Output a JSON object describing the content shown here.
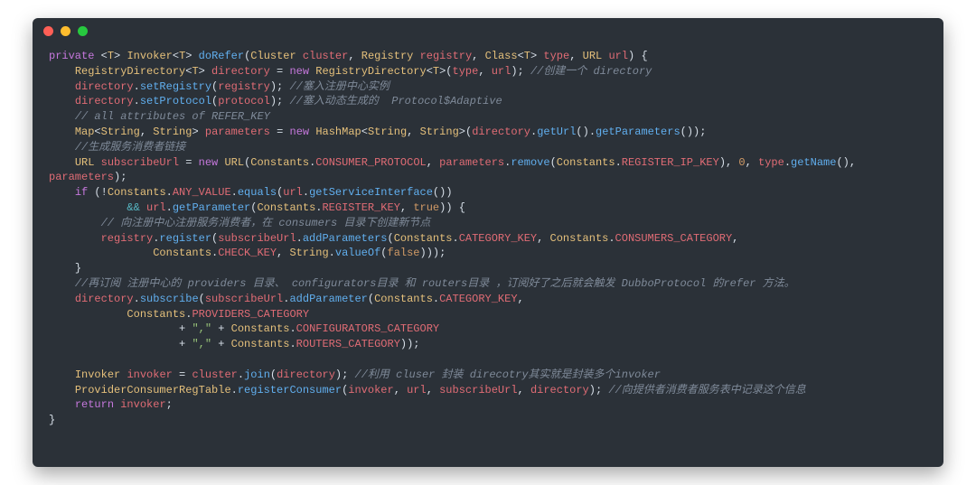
{
  "window": {
    "traffic_colors": {
      "close": "#ff5f56",
      "min": "#ffbd2e",
      "max": "#27c93f"
    }
  },
  "editor": {
    "theme": {
      "bg": "#2b3138",
      "fg": "#d7dfe8",
      "keyword": "#c678dd",
      "type": "#e5c07b",
      "identifier": "#e06c75",
      "method": "#61afef",
      "string": "#98c379",
      "number": "#d19a66",
      "comment": "#7f8a99",
      "operator": "#56b6c2"
    },
    "lines": [
      {
        "ind": 0,
        "t": [
          {
            "c": "kw",
            "s": "private"
          },
          {
            "c": "pln",
            "s": " <"
          },
          {
            "c": "type",
            "s": "T"
          },
          {
            "c": "pln",
            "s": "> "
          },
          {
            "c": "type",
            "s": "Invoker"
          },
          {
            "c": "pln",
            "s": "<"
          },
          {
            "c": "type",
            "s": "T"
          },
          {
            "c": "pln",
            "s": "> "
          },
          {
            "c": "fn",
            "s": "doRefer"
          },
          {
            "c": "pln",
            "s": "("
          },
          {
            "c": "type",
            "s": "Cluster"
          },
          {
            "c": "pln",
            "s": " "
          },
          {
            "c": "id",
            "s": "cluster"
          },
          {
            "c": "pln",
            "s": ", "
          },
          {
            "c": "type",
            "s": "Registry"
          },
          {
            "c": "pln",
            "s": " "
          },
          {
            "c": "id",
            "s": "registry"
          },
          {
            "c": "pln",
            "s": ", "
          },
          {
            "c": "type",
            "s": "Class"
          },
          {
            "c": "pln",
            "s": "<"
          },
          {
            "c": "type",
            "s": "T"
          },
          {
            "c": "pln",
            "s": "> "
          },
          {
            "c": "id",
            "s": "type"
          },
          {
            "c": "pln",
            "s": ", "
          },
          {
            "c": "type",
            "s": "URL"
          },
          {
            "c": "pln",
            "s": " "
          },
          {
            "c": "id",
            "s": "url"
          },
          {
            "c": "pln",
            "s": ") {"
          }
        ]
      },
      {
        "ind": 1,
        "t": [
          {
            "c": "type",
            "s": "RegistryDirectory"
          },
          {
            "c": "pln",
            "s": "<"
          },
          {
            "c": "type",
            "s": "T"
          },
          {
            "c": "pln",
            "s": "> "
          },
          {
            "c": "id",
            "s": "directory"
          },
          {
            "c": "pln",
            "s": " = "
          },
          {
            "c": "kw",
            "s": "new"
          },
          {
            "c": "pln",
            "s": " "
          },
          {
            "c": "type",
            "s": "RegistryDirectory"
          },
          {
            "c": "pln",
            "s": "<"
          },
          {
            "c": "type",
            "s": "T"
          },
          {
            "c": "pln",
            "s": ">("
          },
          {
            "c": "id",
            "s": "type"
          },
          {
            "c": "pln",
            "s": ", "
          },
          {
            "c": "id",
            "s": "url"
          },
          {
            "c": "pln",
            "s": "); "
          },
          {
            "c": "cmt",
            "s": "//创建一个 directory"
          }
        ]
      },
      {
        "ind": 1,
        "t": [
          {
            "c": "id",
            "s": "directory"
          },
          {
            "c": "pln",
            "s": "."
          },
          {
            "c": "fn",
            "s": "setRegistry"
          },
          {
            "c": "pln",
            "s": "("
          },
          {
            "c": "id",
            "s": "registry"
          },
          {
            "c": "pln",
            "s": "); "
          },
          {
            "c": "cmt",
            "s": "//塞入注册中心实例"
          }
        ]
      },
      {
        "ind": 1,
        "t": [
          {
            "c": "id",
            "s": "directory"
          },
          {
            "c": "pln",
            "s": "."
          },
          {
            "c": "fn",
            "s": "setProtocol"
          },
          {
            "c": "pln",
            "s": "("
          },
          {
            "c": "id",
            "s": "protocol"
          },
          {
            "c": "pln",
            "s": "); "
          },
          {
            "c": "cmt",
            "s": "//塞入动态生成的  Protocol$Adaptive"
          }
        ]
      },
      {
        "ind": 1,
        "t": [
          {
            "c": "cmt",
            "s": "// all attributes of REFER_KEY"
          }
        ]
      },
      {
        "ind": 1,
        "t": [
          {
            "c": "type",
            "s": "Map"
          },
          {
            "c": "pln",
            "s": "<"
          },
          {
            "c": "type",
            "s": "String"
          },
          {
            "c": "pln",
            "s": ", "
          },
          {
            "c": "type",
            "s": "String"
          },
          {
            "c": "pln",
            "s": "> "
          },
          {
            "c": "id",
            "s": "parameters"
          },
          {
            "c": "pln",
            "s": " = "
          },
          {
            "c": "kw",
            "s": "new"
          },
          {
            "c": "pln",
            "s": " "
          },
          {
            "c": "type",
            "s": "HashMap"
          },
          {
            "c": "pln",
            "s": "<"
          },
          {
            "c": "type",
            "s": "String"
          },
          {
            "c": "pln",
            "s": ", "
          },
          {
            "c": "type",
            "s": "String"
          },
          {
            "c": "pln",
            "s": ">("
          },
          {
            "c": "id",
            "s": "directory"
          },
          {
            "c": "pln",
            "s": "."
          },
          {
            "c": "fn",
            "s": "getUrl"
          },
          {
            "c": "pln",
            "s": "()."
          },
          {
            "c": "fn",
            "s": "getParameters"
          },
          {
            "c": "pln",
            "s": "());"
          }
        ]
      },
      {
        "ind": 1,
        "t": [
          {
            "c": "cmt",
            "s": "//生成服务消费者链接"
          }
        ]
      },
      {
        "ind": 1,
        "t": [
          {
            "c": "type",
            "s": "URL"
          },
          {
            "c": "pln",
            "s": " "
          },
          {
            "c": "id",
            "s": "subscribeUrl"
          },
          {
            "c": "pln",
            "s": " = "
          },
          {
            "c": "kw",
            "s": "new"
          },
          {
            "c": "pln",
            "s": " "
          },
          {
            "c": "type",
            "s": "URL"
          },
          {
            "c": "pln",
            "s": "("
          },
          {
            "c": "type",
            "s": "Constants"
          },
          {
            "c": "pln",
            "s": "."
          },
          {
            "c": "id",
            "s": "CONSUMER_PROTOCOL"
          },
          {
            "c": "pln",
            "s": ", "
          },
          {
            "c": "id",
            "s": "parameters"
          },
          {
            "c": "pln",
            "s": "."
          },
          {
            "c": "fn",
            "s": "remove"
          },
          {
            "c": "pln",
            "s": "("
          },
          {
            "c": "type",
            "s": "Constants"
          },
          {
            "c": "pln",
            "s": "."
          },
          {
            "c": "id",
            "s": "REGISTER_IP_KEY"
          },
          {
            "c": "pln",
            "s": "), "
          },
          {
            "c": "num",
            "s": "0"
          },
          {
            "c": "pln",
            "s": ", "
          },
          {
            "c": "id",
            "s": "type"
          },
          {
            "c": "pln",
            "s": "."
          },
          {
            "c": "fn",
            "s": "getName"
          },
          {
            "c": "pln",
            "s": "(), "
          }
        ]
      },
      {
        "ind": 0,
        "t": [
          {
            "c": "id",
            "s": "parameters"
          },
          {
            "c": "pln",
            "s": ");"
          }
        ]
      },
      {
        "ind": 1,
        "t": [
          {
            "c": "kw",
            "s": "if"
          },
          {
            "c": "pln",
            "s": " (!"
          },
          {
            "c": "type",
            "s": "Constants"
          },
          {
            "c": "pln",
            "s": "."
          },
          {
            "c": "id",
            "s": "ANY_VALUE"
          },
          {
            "c": "pln",
            "s": "."
          },
          {
            "c": "fn",
            "s": "equals"
          },
          {
            "c": "pln",
            "s": "("
          },
          {
            "c": "id",
            "s": "url"
          },
          {
            "c": "pln",
            "s": "."
          },
          {
            "c": "fn",
            "s": "getServiceInterface"
          },
          {
            "c": "pln",
            "s": "())"
          }
        ]
      },
      {
        "ind": 3,
        "t": [
          {
            "c": "op",
            "s": "&&"
          },
          {
            "c": "pln",
            "s": " "
          },
          {
            "c": "id",
            "s": "url"
          },
          {
            "c": "pln",
            "s": "."
          },
          {
            "c": "fn",
            "s": "getParameter"
          },
          {
            "c": "pln",
            "s": "("
          },
          {
            "c": "type",
            "s": "Constants"
          },
          {
            "c": "pln",
            "s": "."
          },
          {
            "c": "id",
            "s": "REGISTER_KEY"
          },
          {
            "c": "pln",
            "s": ", "
          },
          {
            "c": "num",
            "s": "true"
          },
          {
            "c": "pln",
            "s": ")) {"
          }
        ]
      },
      {
        "ind": 2,
        "t": [
          {
            "c": "cmt",
            "s": "// 向注册中心注册服务消费者，在 consumers 目录下创建新节点"
          }
        ]
      },
      {
        "ind": 2,
        "t": [
          {
            "c": "id",
            "s": "registry"
          },
          {
            "c": "pln",
            "s": "."
          },
          {
            "c": "fn",
            "s": "register"
          },
          {
            "c": "pln",
            "s": "("
          },
          {
            "c": "id",
            "s": "subscribeUrl"
          },
          {
            "c": "pln",
            "s": "."
          },
          {
            "c": "fn",
            "s": "addParameters"
          },
          {
            "c": "pln",
            "s": "("
          },
          {
            "c": "type",
            "s": "Constants"
          },
          {
            "c": "pln",
            "s": "."
          },
          {
            "c": "id",
            "s": "CATEGORY_KEY"
          },
          {
            "c": "pln",
            "s": ", "
          },
          {
            "c": "type",
            "s": "Constants"
          },
          {
            "c": "pln",
            "s": "."
          },
          {
            "c": "id",
            "s": "CONSUMERS_CATEGORY"
          },
          {
            "c": "pln",
            "s": ","
          }
        ]
      },
      {
        "ind": 4,
        "t": [
          {
            "c": "type",
            "s": "Constants"
          },
          {
            "c": "pln",
            "s": "."
          },
          {
            "c": "id",
            "s": "CHECK_KEY"
          },
          {
            "c": "pln",
            "s": ", "
          },
          {
            "c": "type",
            "s": "String"
          },
          {
            "c": "pln",
            "s": "."
          },
          {
            "c": "fn",
            "s": "valueOf"
          },
          {
            "c": "pln",
            "s": "("
          },
          {
            "c": "num",
            "s": "false"
          },
          {
            "c": "pln",
            "s": ")));"
          }
        ]
      },
      {
        "ind": 1,
        "t": [
          {
            "c": "pln",
            "s": "}"
          }
        ]
      },
      {
        "ind": 1,
        "t": [
          {
            "c": "cmt",
            "s": "//再订阅 注册中心的 providers 目录、 configurators目录 和 routers目录 ，订阅好了之后就会触发 DubboProtocol 的refer 方法。"
          }
        ]
      },
      {
        "ind": 1,
        "t": [
          {
            "c": "id",
            "s": "directory"
          },
          {
            "c": "pln",
            "s": "."
          },
          {
            "c": "fn",
            "s": "subscribe"
          },
          {
            "c": "pln",
            "s": "("
          },
          {
            "c": "id",
            "s": "subscribeUrl"
          },
          {
            "c": "pln",
            "s": "."
          },
          {
            "c": "fn",
            "s": "addParameter"
          },
          {
            "c": "pln",
            "s": "("
          },
          {
            "c": "type",
            "s": "Constants"
          },
          {
            "c": "pln",
            "s": "."
          },
          {
            "c": "id",
            "s": "CATEGORY_KEY"
          },
          {
            "c": "pln",
            "s": ","
          }
        ]
      },
      {
        "ind": 3,
        "t": [
          {
            "c": "type",
            "s": "Constants"
          },
          {
            "c": "pln",
            "s": "."
          },
          {
            "c": "id",
            "s": "PROVIDERS_CATEGORY"
          }
        ]
      },
      {
        "ind": 5,
        "t": [
          {
            "c": "pln",
            "s": "+ "
          },
          {
            "c": "str",
            "s": "\",\""
          },
          {
            "c": "pln",
            "s": " + "
          },
          {
            "c": "type",
            "s": "Constants"
          },
          {
            "c": "pln",
            "s": "."
          },
          {
            "c": "id",
            "s": "CONFIGURATORS_CATEGORY"
          }
        ]
      },
      {
        "ind": 5,
        "t": [
          {
            "c": "pln",
            "s": "+ "
          },
          {
            "c": "str",
            "s": "\",\""
          },
          {
            "c": "pln",
            "s": " + "
          },
          {
            "c": "type",
            "s": "Constants"
          },
          {
            "c": "pln",
            "s": "."
          },
          {
            "c": "id",
            "s": "ROUTERS_CATEGORY"
          },
          {
            "c": "pln",
            "s": "));"
          }
        ]
      },
      {
        "ind": 0,
        "t": [
          {
            "c": "pln",
            "s": ""
          }
        ]
      },
      {
        "ind": 1,
        "t": [
          {
            "c": "type",
            "s": "Invoker"
          },
          {
            "c": "pln",
            "s": " "
          },
          {
            "c": "id",
            "s": "invoker"
          },
          {
            "c": "pln",
            "s": " = "
          },
          {
            "c": "id",
            "s": "cluster"
          },
          {
            "c": "pln",
            "s": "."
          },
          {
            "c": "fn",
            "s": "join"
          },
          {
            "c": "pln",
            "s": "("
          },
          {
            "c": "id",
            "s": "directory"
          },
          {
            "c": "pln",
            "s": "); "
          },
          {
            "c": "cmt",
            "s": "//利用 cluser 封装 direcotry其实就是封装多个invoker"
          }
        ]
      },
      {
        "ind": 1,
        "t": [
          {
            "c": "type",
            "s": "ProviderConsumerRegTable"
          },
          {
            "c": "pln",
            "s": "."
          },
          {
            "c": "fn",
            "s": "registerConsumer"
          },
          {
            "c": "pln",
            "s": "("
          },
          {
            "c": "id",
            "s": "invoker"
          },
          {
            "c": "pln",
            "s": ", "
          },
          {
            "c": "id",
            "s": "url"
          },
          {
            "c": "pln",
            "s": ", "
          },
          {
            "c": "id",
            "s": "subscribeUrl"
          },
          {
            "c": "pln",
            "s": ", "
          },
          {
            "c": "id",
            "s": "directory"
          },
          {
            "c": "pln",
            "s": "); "
          },
          {
            "c": "cmt",
            "s": "//向提供者消费者服务表中记录这个信息"
          }
        ]
      },
      {
        "ind": 1,
        "t": [
          {
            "c": "kw",
            "s": "return"
          },
          {
            "c": "pln",
            "s": " "
          },
          {
            "c": "id",
            "s": "invoker"
          },
          {
            "c": "pln",
            "s": ";"
          }
        ]
      },
      {
        "ind": 0,
        "t": [
          {
            "c": "pln",
            "s": "}"
          }
        ]
      }
    ]
  }
}
